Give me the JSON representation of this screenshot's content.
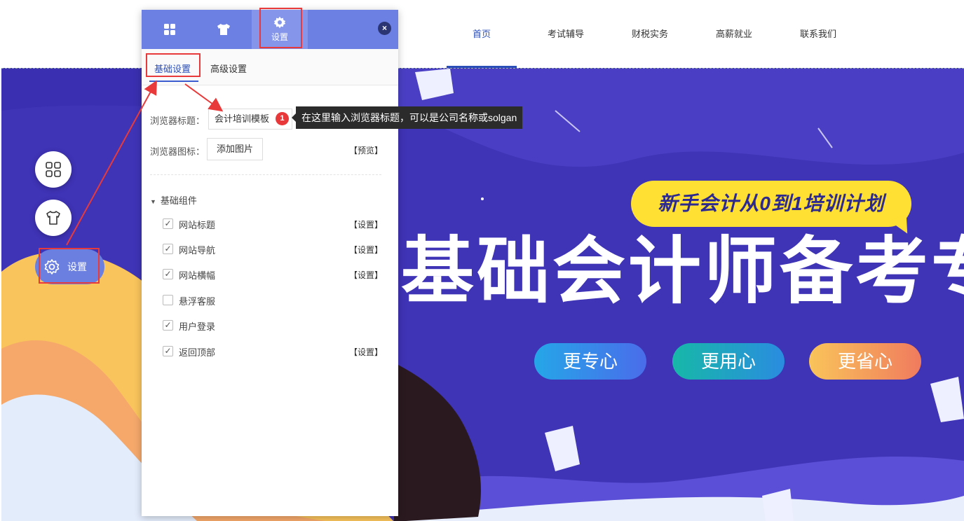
{
  "nav": {
    "items": [
      "首页",
      "考试辅导",
      "财税实务",
      "高薪就业",
      "联系我们"
    ],
    "active_index": 0
  },
  "banner": {
    "bubble_text": "新手会计从0到1培训计划",
    "headline": "基础会计师备考专",
    "pills": [
      "更专心",
      "更用心",
      "更省心"
    ]
  },
  "fab": {
    "icons": [
      "grid-icon",
      "tshirt-icon",
      "gear-icon"
    ],
    "settings_label": "设置"
  },
  "panel": {
    "tabs": [
      {
        "icon": "grid-icon",
        "label": ""
      },
      {
        "icon": "tshirt-icon",
        "label": ""
      },
      {
        "icon": "gear-icon",
        "label": "设置"
      }
    ],
    "close": "×",
    "subtabs": [
      "基础设置",
      "高级设置"
    ],
    "browser_title_label": "浏览器标题：",
    "browser_title_value": "会计培训模板",
    "browser_icon_label": "浏览器图标：",
    "add_image": "添加图片",
    "preview": "【预览】",
    "group_title": "基础组件",
    "components": [
      {
        "label": "网站标题",
        "checked": true,
        "link": "【设置】"
      },
      {
        "label": "网站导航",
        "checked": true,
        "link": "【设置】"
      },
      {
        "label": "网站横幅",
        "checked": true,
        "link": "【设置】"
      },
      {
        "label": "悬浮客服",
        "checked": false,
        "link": ""
      },
      {
        "label": "用户登录",
        "checked": true,
        "link": ""
      },
      {
        "label": "返回顶部",
        "checked": true,
        "link": "【设置】"
      }
    ]
  },
  "tooltip": {
    "badge": "1",
    "text": "在这里输入浏览器标题，可以是公司名称或solgan"
  },
  "colors": {
    "accent": "#2a4eb8",
    "panel_header": "#6c80e4",
    "annotation_red": "#e83a3a",
    "banner_bg": "#3f33b6",
    "bubble": "#ffe033"
  }
}
